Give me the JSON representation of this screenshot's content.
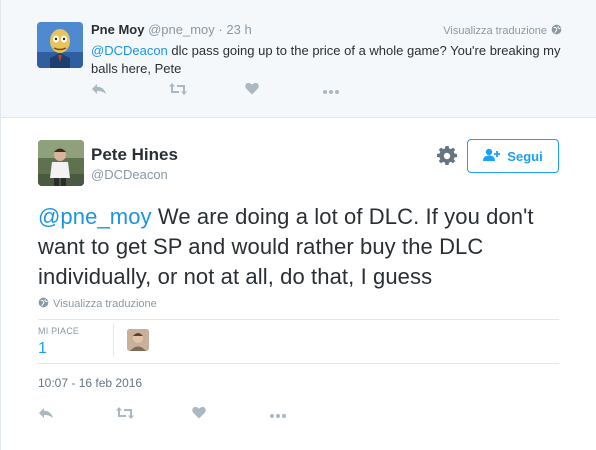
{
  "reply": {
    "author_name": "Pne Moy",
    "author_handle": "@pne_moy",
    "separator": "·",
    "time": "23 h",
    "translate_label": "Visualizza traduzione",
    "mention": "@DCDeacon",
    "text": " dlc pass going up to the price of a whole game? You're breaking my balls here,  Pete",
    "actions": [
      "reply-icon",
      "retweet-icon",
      "like-icon",
      "more-icon"
    ]
  },
  "tweet": {
    "author_name": "Pete Hines",
    "author_handle": "@DCDeacon",
    "follow_label": "Segui",
    "mention": "@pne_moy",
    "text": " We are doing a lot of DLC. If you don't want to get SP and would rather buy the DLC individually, or not at all, do that, I guess",
    "translate_label": "Visualizza traduzione",
    "likes_label": "MI PIACE",
    "likes_count": "1",
    "timestamp": "10:07 - 16 feb 2016",
    "actions": [
      "reply-icon",
      "retweet-icon",
      "like-icon",
      "more-icon"
    ]
  },
  "colors": {
    "accent": "#1da1f2",
    "mention": "#1b95e0",
    "muted": "#8899a6",
    "icon": "#aab8c2",
    "reply_background": "#f5f8fa"
  }
}
